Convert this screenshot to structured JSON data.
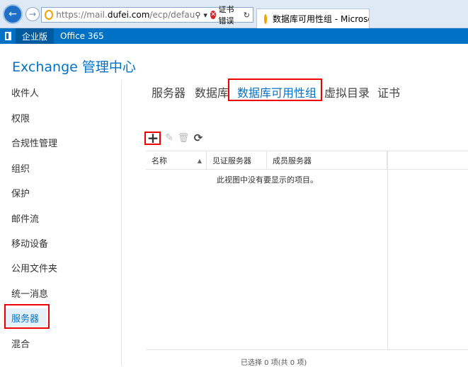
{
  "browser": {
    "url_prefix": "https://mail.",
    "url_host": "dufei.com",
    "url_rest": "/ecp/defau",
    "cert_error": "证书错误",
    "tab_title": "数据库可用性组 - Microso...",
    "tab_close": "×"
  },
  "suite": {
    "items": [
      "企业版",
      "Office 365"
    ]
  },
  "app": {
    "title": "Exchange 管理中心"
  },
  "left_nav": {
    "items": [
      "收件人",
      "权限",
      "合规性管理",
      "组织",
      "保护",
      "邮件流",
      "移动设备",
      "公用文件夹",
      "统一消息",
      "服务器",
      "混合"
    ],
    "active_index": 9
  },
  "top_tabs": {
    "items": [
      "服务器",
      "数据库",
      "数据库可用性组",
      "虚拟目录",
      "证书"
    ],
    "active_index": 2
  },
  "toolbar": {
    "icons": [
      "add-icon",
      "edit-icon",
      "delete-icon",
      "refresh-icon"
    ]
  },
  "grid": {
    "columns": [
      "名称",
      "见证服务器",
      "成员服务器"
    ],
    "empty_message": "此视图中没有要显示的项目。"
  },
  "status": {
    "text": "已选择 0 项(共 0 项)"
  },
  "colors": {
    "accent": "#0072c6",
    "highlight_box": "#e00000"
  }
}
